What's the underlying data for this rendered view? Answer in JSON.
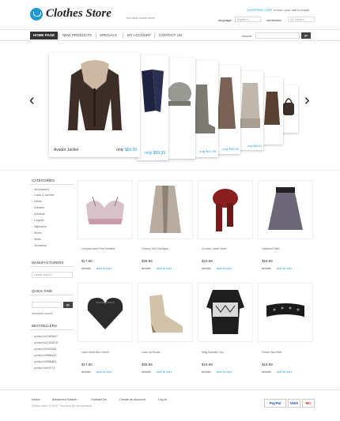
{
  "header": {
    "logo_text": "Clothes Store",
    "tagline": "the best online store",
    "cart": {
      "link": "SHOPPING CART",
      "status": "is now: your cart is empty"
    },
    "language_label": "language:",
    "language_value": "English",
    "currencies_label": "currencies:",
    "currency_value": "US Dollar"
  },
  "nav": {
    "items": [
      "HOME PAGE",
      "NEW PRODUCTS",
      "SPECIALS",
      "MY ACCOUNT",
      "CONTACT US"
    ],
    "search_label": "search:",
    "search_button": "go"
  },
  "slider": {
    "main": {
      "name": "Aviator Jacket",
      "price_prefix": "only",
      "price": "$69.99"
    },
    "others": [
      {
        "price_prefix": "only",
        "price": "$59.99"
      },
      {
        "price_prefix": "only",
        "price": "$47.99"
      },
      {
        "price_prefix": "only",
        "price": "$35.99"
      },
      {
        "price_prefix": "only",
        "price": "$49.99"
      }
    ],
    "prev": "‹",
    "next": "›"
  },
  "sidebar": {
    "categories_title": "CATEGORIES",
    "categories": [
      "Accessories",
      "Coats & Jackets",
      "Denim",
      "Dresses",
      "Knitwear",
      "Lingerie",
      "Nightwear",
      "Shoes",
      "Skirts",
      "Swimwear"
    ],
    "manufacturers_title": "MANUFACTURERS",
    "manufacturers_select": "please select",
    "quickfind_title": "QUICK FIND",
    "quickfind_button": "go",
    "advanced_search": "advanced search",
    "bestsellers_title": "BESTSELLERS",
    "bestsellers": [
      "product #12905467",
      "product #12345678",
      "product #9440466",
      "product #9868443",
      "product #3956884",
      "product #445774"
    ]
  },
  "products": [
    {
      "name": "Leopard-lace Flora Bralette",
      "price": "$17.90",
      "details": "details",
      "cart": "add to cart"
    },
    {
      "name": "Chunky Knit Cardigan",
      "price": "$39.95",
      "details": "details",
      "cart": "add to cart"
    },
    {
      "name": "Circular Cable Scarf",
      "price": "$19.69",
      "details": "details",
      "cart": "add to cart"
    },
    {
      "name": "Gathered Skirt",
      "price": "$19.99",
      "details": "details",
      "cart": "add to cart"
    },
    {
      "name": "Lace Heart Box Clutch",
      "price": "$17.90",
      "details": "details",
      "cart": "add to cart"
    },
    {
      "name": "Lace Up Bootie",
      "price": "$39.95",
      "details": "details",
      "cart": "add to cart"
    },
    {
      "name": "Stag Sweater Top",
      "price": "$19.69",
      "details": "details",
      "cart": "add to cart"
    },
    {
      "name": "Future Stud Belt",
      "price": "$19.99",
      "details": "details",
      "cart": "add to cart"
    }
  ],
  "footer": {
    "links": [
      "Home",
      "Advanced Search",
      "Contact Us",
      "Create an Account",
      "Log In"
    ],
    "copyright": "Clothes store © 2013 · Powered by osCommerce",
    "payments": [
      "PayPal",
      "VISA",
      "MC"
    ]
  },
  "colors": {
    "accent": "#1c9bd7",
    "nav_active": "#333333"
  }
}
